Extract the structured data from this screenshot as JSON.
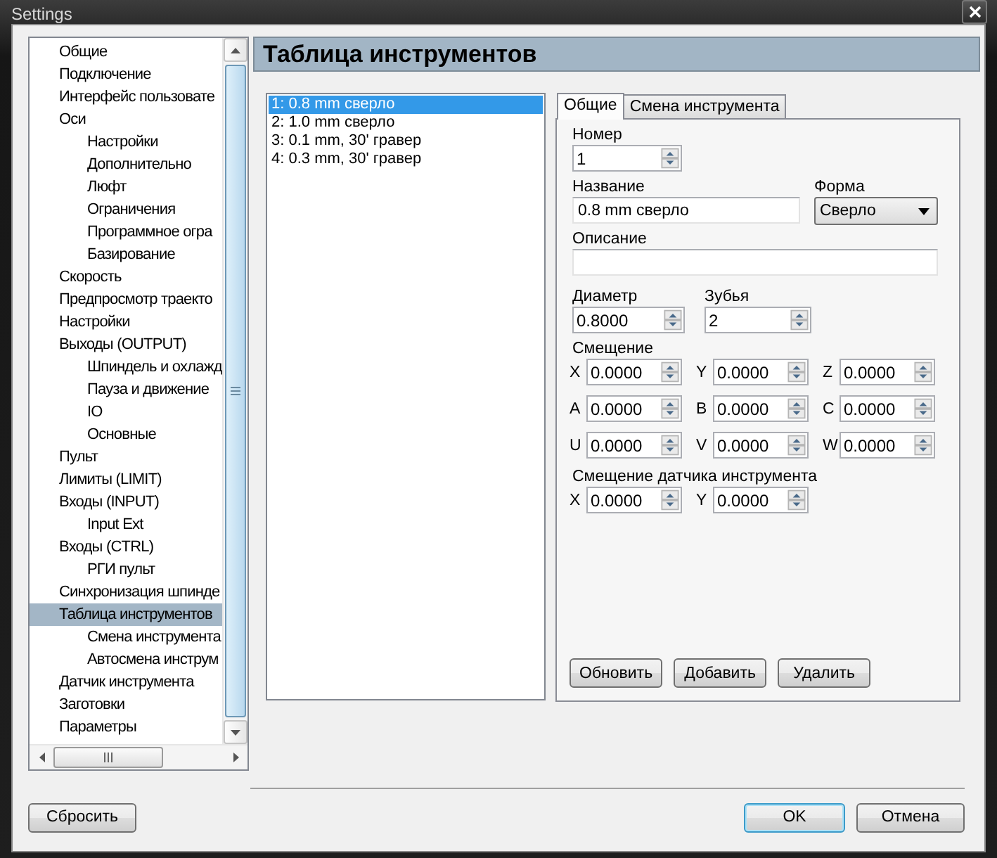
{
  "window": {
    "title": "Settings"
  },
  "tree": {
    "items": [
      {
        "label": "Общие",
        "selected": false
      },
      {
        "label": "Подключение",
        "selected": false
      },
      {
        "label": "Интерфейс пользовате",
        "selected": false
      },
      {
        "label": "Оси",
        "selected": false,
        "children": [
          {
            "label": "Настройки",
            "selected": false
          },
          {
            "label": "Дополнительно",
            "selected": false
          },
          {
            "label": "Люфт",
            "selected": false
          },
          {
            "label": "Ограничения",
            "selected": false
          },
          {
            "label": "Программное огра",
            "selected": false
          },
          {
            "label": "Базирование",
            "selected": false
          }
        ]
      },
      {
        "label": "Скорость",
        "selected": false
      },
      {
        "label": "Предпросмотр траекто",
        "selected": false
      },
      {
        "label": "Настройки",
        "selected": false
      },
      {
        "label": "Выходы (OUTPUT)",
        "selected": false,
        "children": [
          {
            "label": "Шпиндель и охлажд",
            "selected": false
          },
          {
            "label": "Пауза и движение",
            "selected": false
          },
          {
            "label": "IO",
            "selected": false
          },
          {
            "label": "Основные",
            "selected": false
          }
        ]
      },
      {
        "label": "Пульт",
        "selected": false
      },
      {
        "label": "Лимиты (LIMIT)",
        "selected": false
      },
      {
        "label": "Входы (INPUT)",
        "selected": false,
        "children": [
          {
            "label": "Input Ext",
            "selected": false
          }
        ]
      },
      {
        "label": "Входы (CTRL)",
        "selected": false,
        "children": [
          {
            "label": "РГИ пульт",
            "selected": false
          }
        ]
      },
      {
        "label": "Синхронизация шпинде",
        "selected": false
      },
      {
        "label": "Таблица инструментов",
        "selected": true,
        "children": [
          {
            "label": "Смена инструмента",
            "selected": false
          },
          {
            "label": "Автосмена инструм",
            "selected": false
          }
        ]
      },
      {
        "label": "Датчик инструмента",
        "selected": false
      },
      {
        "label": "Заготовки",
        "selected": false
      },
      {
        "label": "Параметры",
        "selected": false
      }
    ]
  },
  "page_title": "Таблица инструментов",
  "tool_list": [
    {
      "label": "1: 0.8 mm сверло",
      "selected": true
    },
    {
      "label": "2: 1.0 mm сверло",
      "selected": false
    },
    {
      "label": "3: 0.1 mm, 30' гравер",
      "selected": false
    },
    {
      "label": "4: 0.3 mm, 30' гравер",
      "selected": false
    }
  ],
  "tabs": [
    {
      "label": "Общие",
      "selected": true
    },
    {
      "label": "Смена инструмента",
      "selected": false
    }
  ],
  "form": {
    "number": {
      "label": "Номер",
      "value": "1"
    },
    "name": {
      "label": "Название",
      "value": "0.8 mm сверло"
    },
    "shape": {
      "label": "Форма",
      "value": "Сверло"
    },
    "description": {
      "label": "Описание"
    },
    "diameter": {
      "label": "Диаметр",
      "value": "0.8000"
    },
    "teeth": {
      "label": "Зубья",
      "value": "2"
    },
    "offset": {
      "label": "Смещение",
      "fields": [
        {
          "axis": "X",
          "value": "0.0000"
        },
        {
          "axis": "Y",
          "value": "0.0000"
        },
        {
          "axis": "Z",
          "value": "0.0000"
        },
        {
          "axis": "A",
          "value": "0.0000"
        },
        {
          "axis": "B",
          "value": "0.0000"
        },
        {
          "axis": "C",
          "value": "0.0000"
        },
        {
          "axis": "U",
          "value": "0.0000"
        },
        {
          "axis": "V",
          "value": "0.0000"
        },
        {
          "axis": "W",
          "value": "0.0000"
        }
      ]
    },
    "probe_offset": {
      "label": "Смещение датчика инструмента",
      "fields": [
        {
          "axis": "X",
          "value": "0.0000"
        },
        {
          "axis": "Y",
          "value": "0.0000"
        }
      ]
    },
    "buttons": [
      "Обновить",
      "Добавить",
      "Удалить"
    ]
  },
  "footer": {
    "reset": "Сбросить",
    "buttons": [
      {
        "label": "OK",
        "default": true
      },
      {
        "label": "Отмена",
        "default": false
      }
    ]
  }
}
